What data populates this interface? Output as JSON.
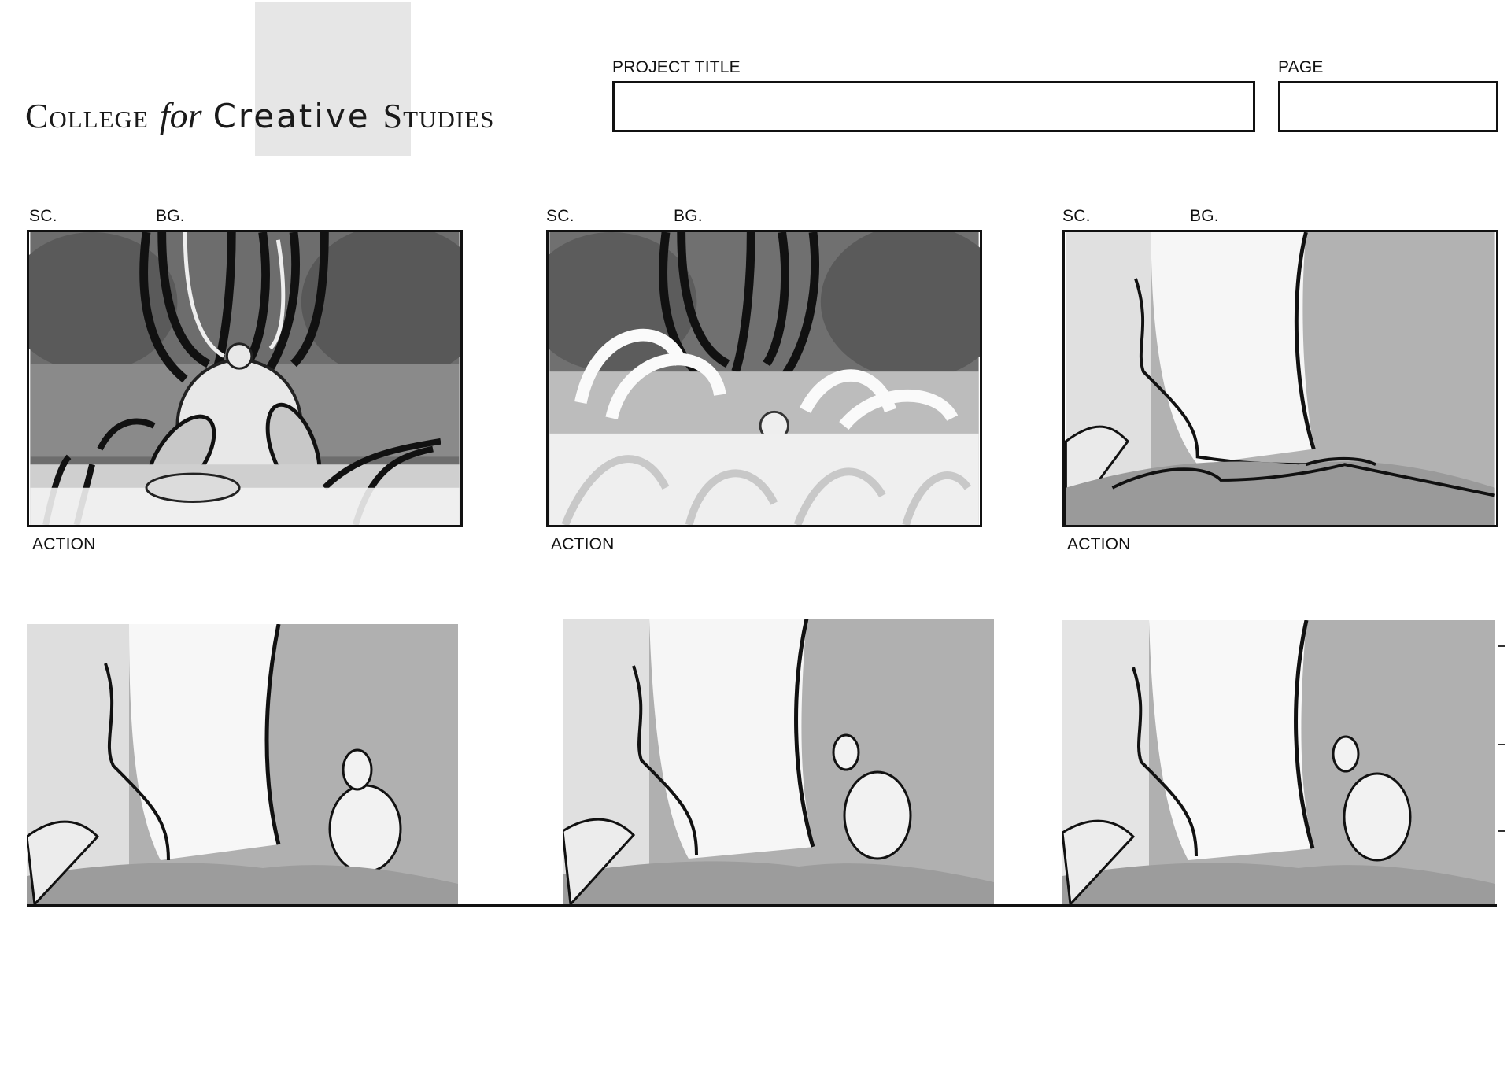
{
  "header": {
    "logo": {
      "college": "College",
      "for": "for",
      "creative": "Creative",
      "studies": "Studies"
    },
    "project_title_label": "PROJECT TITLE",
    "project_title_value": "",
    "page_label": "PAGE",
    "page_value": ""
  },
  "panels_row1": [
    {
      "sc_label": "SC.",
      "bg_label": "BG.",
      "action_label": "ACTION",
      "scene": "tree-canopy-rabbit-back"
    },
    {
      "sc_label": "SC.",
      "bg_label": "BG.",
      "action_label": "ACTION",
      "scene": "tree-canopy-grass-swirl"
    },
    {
      "sc_label": "SC.",
      "bg_label": "BG.",
      "action_label": "ACTION",
      "scene": "tree-trunk-roots"
    }
  ],
  "panels_row2": [
    {
      "scene": "tree-trunk-rabbit-sitting"
    },
    {
      "scene": "tree-trunk-rabbit-reaching"
    },
    {
      "scene": "tree-trunk-rabbit-reaching-2"
    }
  ],
  "colors": {
    "ink": "#111111",
    "mid_gray": "#b3b3b3",
    "light_gray": "#e2e2e2",
    "dark_gray": "#5a5a5a",
    "logo_block": "#e6e6e6"
  }
}
